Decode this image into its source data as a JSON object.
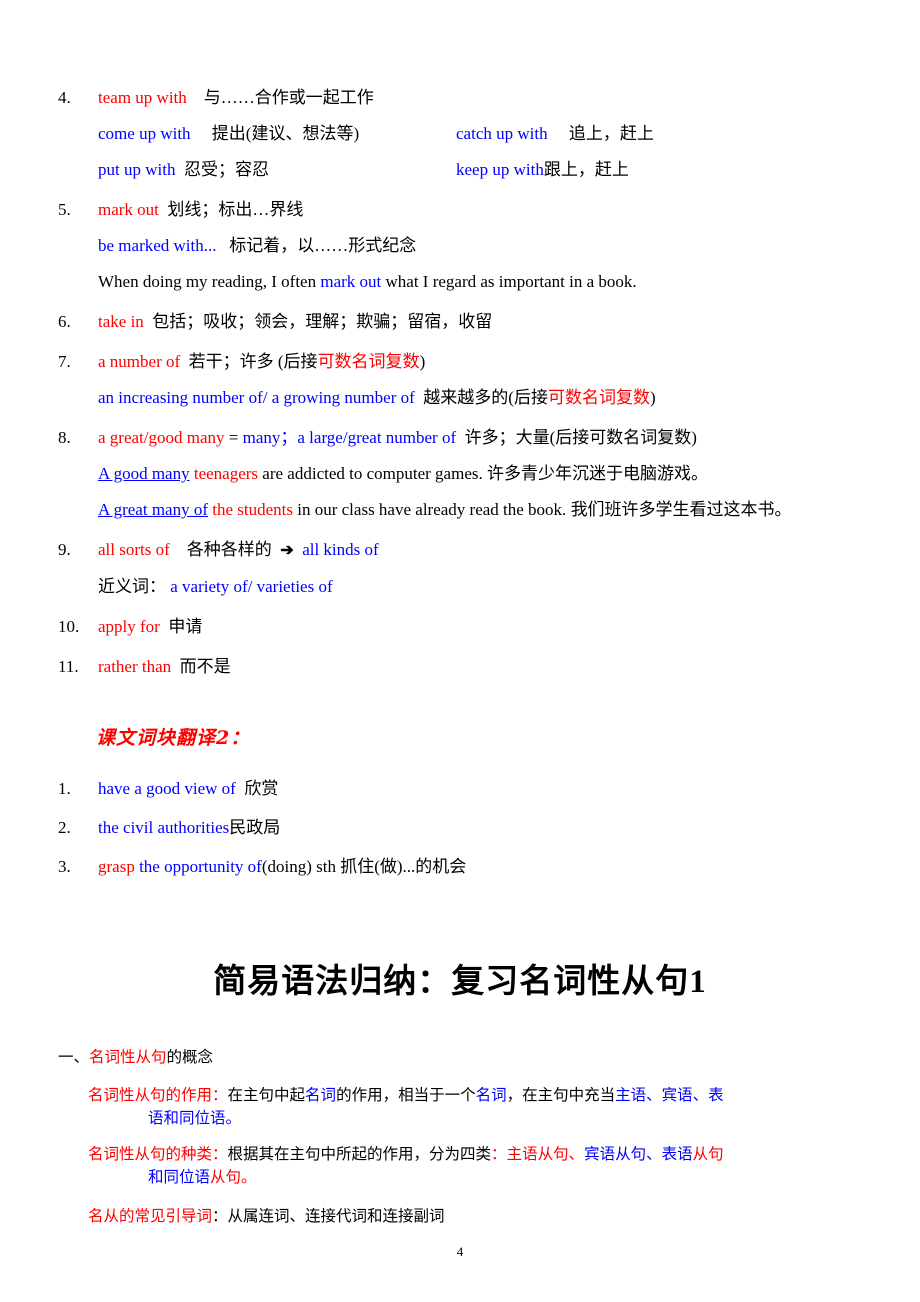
{
  "page": {
    "number": "4"
  },
  "vocab_section_1": {
    "items": [
      {
        "num": "4.",
        "line1_red": "team up with",
        "line1_black": "与……合作或一起工作",
        "row2_left_blue": "come up with",
        "row2_left_black": "提出(建议、想法等)",
        "row2_right_blue": "catch up with",
        "row2_right_black": "追上，赶上",
        "row3_left_blue": "put up with",
        "row3_left_black": "忍受；容忍",
        "row3_right_blue": "keep up with",
        "row3_right_black": "跟上，赶上"
      },
      {
        "num": "5.",
        "line1_red": "mark out",
        "line1_black": "划线；标出…界线",
        "sub1_blue": "be marked with...",
        "sub1_black": "标记着，以……形式纪念",
        "example_pre": "When doing my reading, I often ",
        "example_blue": "mark out",
        "example_post": " what I regard as important in a book."
      },
      {
        "num": "6.",
        "line1_red": "take in",
        "line1_black": "包括；吸收；领会，理解；欺骗；留宿，收留"
      },
      {
        "num": "7.",
        "line1_red": "a number of",
        "line1_black": "若干；许多 (后接",
        "line1_red2": "可数名词复数",
        "line1_black2": ")",
        "sub1_blue": "an increasing number of/ a growing number of",
        "sub1_black": "越来越多的(后接",
        "sub1_red": "可数名词复数",
        "sub1_black2": ")"
      },
      {
        "num": "8.",
        "line1_red": "a great/good many",
        "line1_eq": "=",
        "line1_blue": "many；a large/great number of",
        "line1_black": "许多；大量(后接可数名词复数)",
        "ex1_blue_underline": "A good many",
        "ex1_red": "teenagers",
        "ex1_black": " are addicted to computer games.",
        "ex1_cn": "许多青少年沉迷于电脑游戏。",
        "ex2_blue_underline": "A great many of",
        "ex2_red": "the students",
        "ex2_black": " in our class have already read the book.",
        "ex2_cn": "我们班许多学生看过这本书。"
      },
      {
        "num": "9.",
        "line1_red": "all sorts of",
        "line1_black": "各种各样的",
        "arrow": "➔",
        "line1_blue": "all kinds of",
        "sub1_black": "近义词：",
        "sub1_blue": "a variety of/ varieties of"
      },
      {
        "num": "10.",
        "line1_red": "apply for",
        "line1_black": "申请"
      },
      {
        "num": "11.",
        "line1_red": "rather than",
        "line1_black": "而不是"
      }
    ]
  },
  "vocab_section_2": {
    "heading": "课文词块翻译2：",
    "items": [
      {
        "num": "1.",
        "blue": "have a good view of",
        "black": "欣赏"
      },
      {
        "num": "2.",
        "blue": "the civil authorities",
        "black": "民政局"
      },
      {
        "num": "3.",
        "red": "grasp",
        "blue": "the opportunity of",
        "black": "(doing) sth  抓住(做)...的机会"
      }
    ]
  },
  "grammar": {
    "title": "简易语法归纳：复习名词性从句1",
    "h1_num": "一、",
    "h1_red": "名词性从句",
    "h1_black": "的概念",
    "p1": {
      "label_red": "名词性从句的作用",
      "label_sep": "：",
      "t1": "在主句中起",
      "b1": "名词",
      "t2": "的作用，相当于一个",
      "b2": "名词",
      "t3": "，在主句中充当",
      "b3": "主语、宾语、表",
      "wrap_blue": "语和同位语",
      "wrap_end": "。"
    },
    "p2": {
      "label_red": "名词性从句的种类",
      "label_sep": "：",
      "t1": "根据其在主句中所起的作用，分为四类",
      "sep2": "：",
      "r1": "主语从句、",
      "b1": "宾语从句、表语",
      "r2": "从句",
      "wrap_blue": "和同位语",
      "wrap_red": "从句",
      "wrap_end": "。"
    },
    "p3": {
      "label_red": "名从的常见引导词",
      "black": "：从属连词、连接代词和连接副词"
    }
  },
  "colors": {
    "red": "#ff0000",
    "blue": "#0000ff",
    "black": "#000000"
  }
}
